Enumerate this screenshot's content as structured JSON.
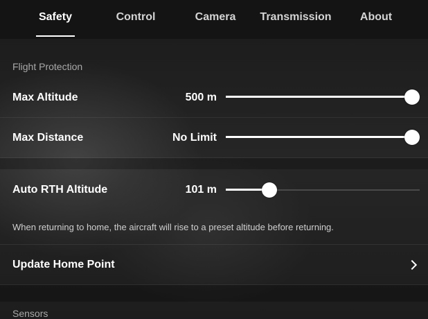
{
  "tabs": [
    {
      "label": "Safety",
      "active": true
    },
    {
      "label": "Control",
      "active": false
    },
    {
      "label": "Camera",
      "active": false
    },
    {
      "label": "Transmission",
      "active": false
    },
    {
      "label": "About",
      "active": false
    }
  ],
  "flight_protection": {
    "header": "Flight Protection",
    "max_altitude": {
      "label": "Max Altitude",
      "value": "500 m",
      "slider_fraction": 1.0
    },
    "max_distance": {
      "label": "Max Distance",
      "value": "No Limit",
      "slider_fraction": 1.0
    }
  },
  "rth": {
    "label": "Auto RTH Altitude",
    "value": "101 m",
    "slider_fraction": 0.2,
    "description": "When returning to home, the aircraft will rise to a preset altitude before returning."
  },
  "home_point": {
    "label": "Update Home Point",
    "icon": "chevron-right-icon"
  },
  "sensors": {
    "header": "Sensors"
  },
  "colors": {
    "accent": "#ffffff",
    "background": "#1c1c1e",
    "track": "#4a4a4a"
  }
}
